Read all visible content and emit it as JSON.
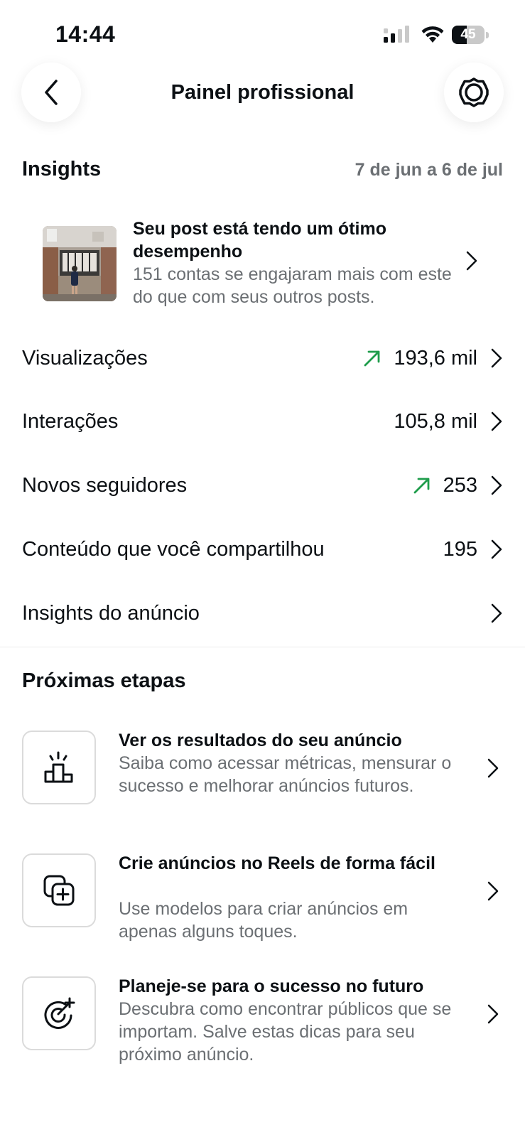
{
  "status_bar": {
    "time": "14:44",
    "battery": "45",
    "battery_level_percent": 45
  },
  "header": {
    "title": "Painel profissional"
  },
  "insights": {
    "title": "Insights",
    "date_range": "7 de jun a 6 de jul",
    "highlight": {
      "title": "Seu post está tendo um ótimo desempenho",
      "description": "151 contas se engajaram mais com este do que com seus outros posts."
    },
    "metrics": [
      {
        "label": "Visualizações",
        "value": "193,6 mil",
        "trend": "up"
      },
      {
        "label": "Interações",
        "value": "105,8 mil",
        "trend": ""
      },
      {
        "label": "Novos seguidores",
        "value": "253",
        "trend": "up"
      },
      {
        "label": "Conteúdo que você compartilhou",
        "value": "195",
        "trend": ""
      },
      {
        "label": "Insights do anúncio",
        "value": "",
        "trend": ""
      }
    ]
  },
  "next_steps": {
    "title": "Próximas etapas",
    "items": [
      {
        "icon": "podium-icon",
        "title": "Ver os resultados do seu anúncio",
        "description": "Saiba como acessar métricas, mensurar o sucesso e melhorar anúncios futuros."
      },
      {
        "icon": "add-reels-icon",
        "title": "Crie anúncios no Reels de forma fácil",
        "description": "Use modelos para criar anúncios em apenas alguns toques."
      },
      {
        "icon": "target-sparkle-icon",
        "title": "Planeje-se para o sucesso no futuro",
        "description": "Descubra como encontrar públicos que se importam. Salve estas dicas para seu próximo anúncio."
      }
    ]
  },
  "colors": {
    "trend_up": "#1f9d4c",
    "secondary_text": "#6b6f73",
    "primary_text": "#0c1014"
  }
}
